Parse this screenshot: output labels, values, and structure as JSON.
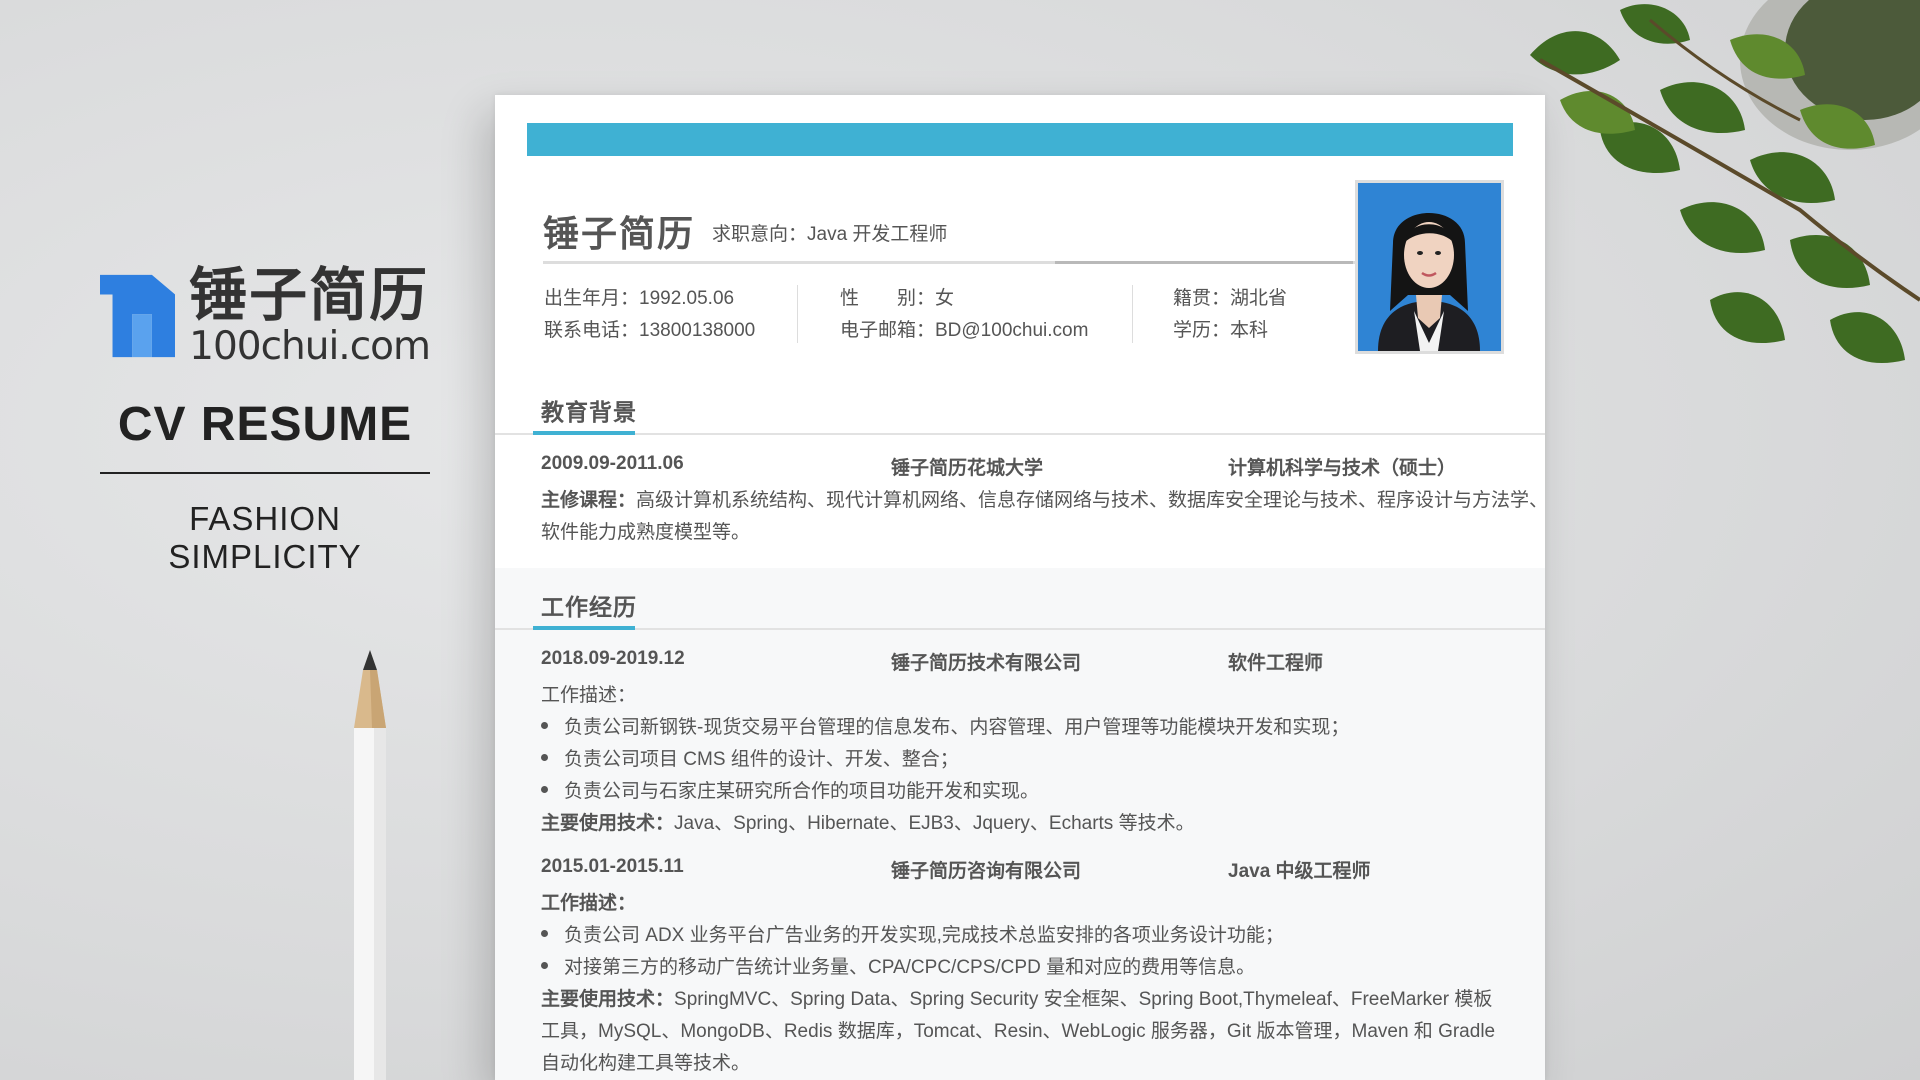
{
  "brand": {
    "name_cn": "锤子简历",
    "url": "100chui.com",
    "title": "CV RESUME",
    "subtitle": "FASHION  SIMPLICITY",
    "logo_color": "#2e7fe0"
  },
  "resume": {
    "accent_color": "#3fb1d3",
    "name": "锤子简历",
    "intent_label": "求职意向：",
    "intent_value": "Java 开发工程师",
    "info": {
      "birth": "出生年月：1992.05.06",
      "phone": "联系电话：13800138000",
      "gender": "性　　别：女",
      "email": "电子邮箱：BD@100chui.com",
      "origin": "籍贯：湖北省",
      "degree": "学历：本科"
    },
    "education": {
      "title": "教育背景",
      "period": "2009.09-2011.06",
      "school": "锤子简历花城大学",
      "major": "计算机科学与技术（硕士）",
      "courses_label": "主修课程：",
      "courses_line1": "高级计算机系统结构、现代计算机网络、信息存储网络与技术、数据库安全理论与技术、程序设计与方法学、",
      "courses_line2": "软件能力成熟度模型等。"
    },
    "work": {
      "title": "工作经历",
      "jobs": [
        {
          "period": "2018.09-2019.12",
          "company": "锤子简历技术有限公司",
          "position": "软件工程师",
          "desc_label": "工作描述：",
          "bullets": [
            "负责公司新钢铁-现货交易平台管理的信息发布、内容管理、用户管理等功能模块开发和实现；",
            "负责公司项目 CMS 组件的设计、开发、整合；",
            "负责公司与石家庄某研究所合作的项目功能开发和实现。"
          ],
          "tech_label": "主要使用技术：",
          "tech": "Java、Spring、Hibernate、EJB3、Jquery、Echarts 等技术。"
        },
        {
          "period": "2015.01-2015.11",
          "company": "锤子简历咨询有限公司",
          "position": "Java 中级工程师",
          "desc_label": "工作描述：",
          "bullets": [
            "负责公司 ADX 业务平台广告业务的开发实现,完成技术总监安排的各项业务设计功能；",
            "对接第三方的移动广告统计业务量、CPA/CPC/CPS/CPD 量和对应的费用等信息。"
          ],
          "tech_label": "主要使用技术：",
          "tech_line1": "SpringMVC、Spring Data、Spring Security 安全框架、Spring Boot,Thymeleaf、FreeMarker 模板",
          "tech_line2": "工具，MySQL、MongoDB、Redis 数据库，Tomcat、Resin、WebLogic 服务器，Git 版本管理，Maven 和 Gradle",
          "tech_line3": "自动化构建工具等技术。"
        }
      ]
    }
  }
}
